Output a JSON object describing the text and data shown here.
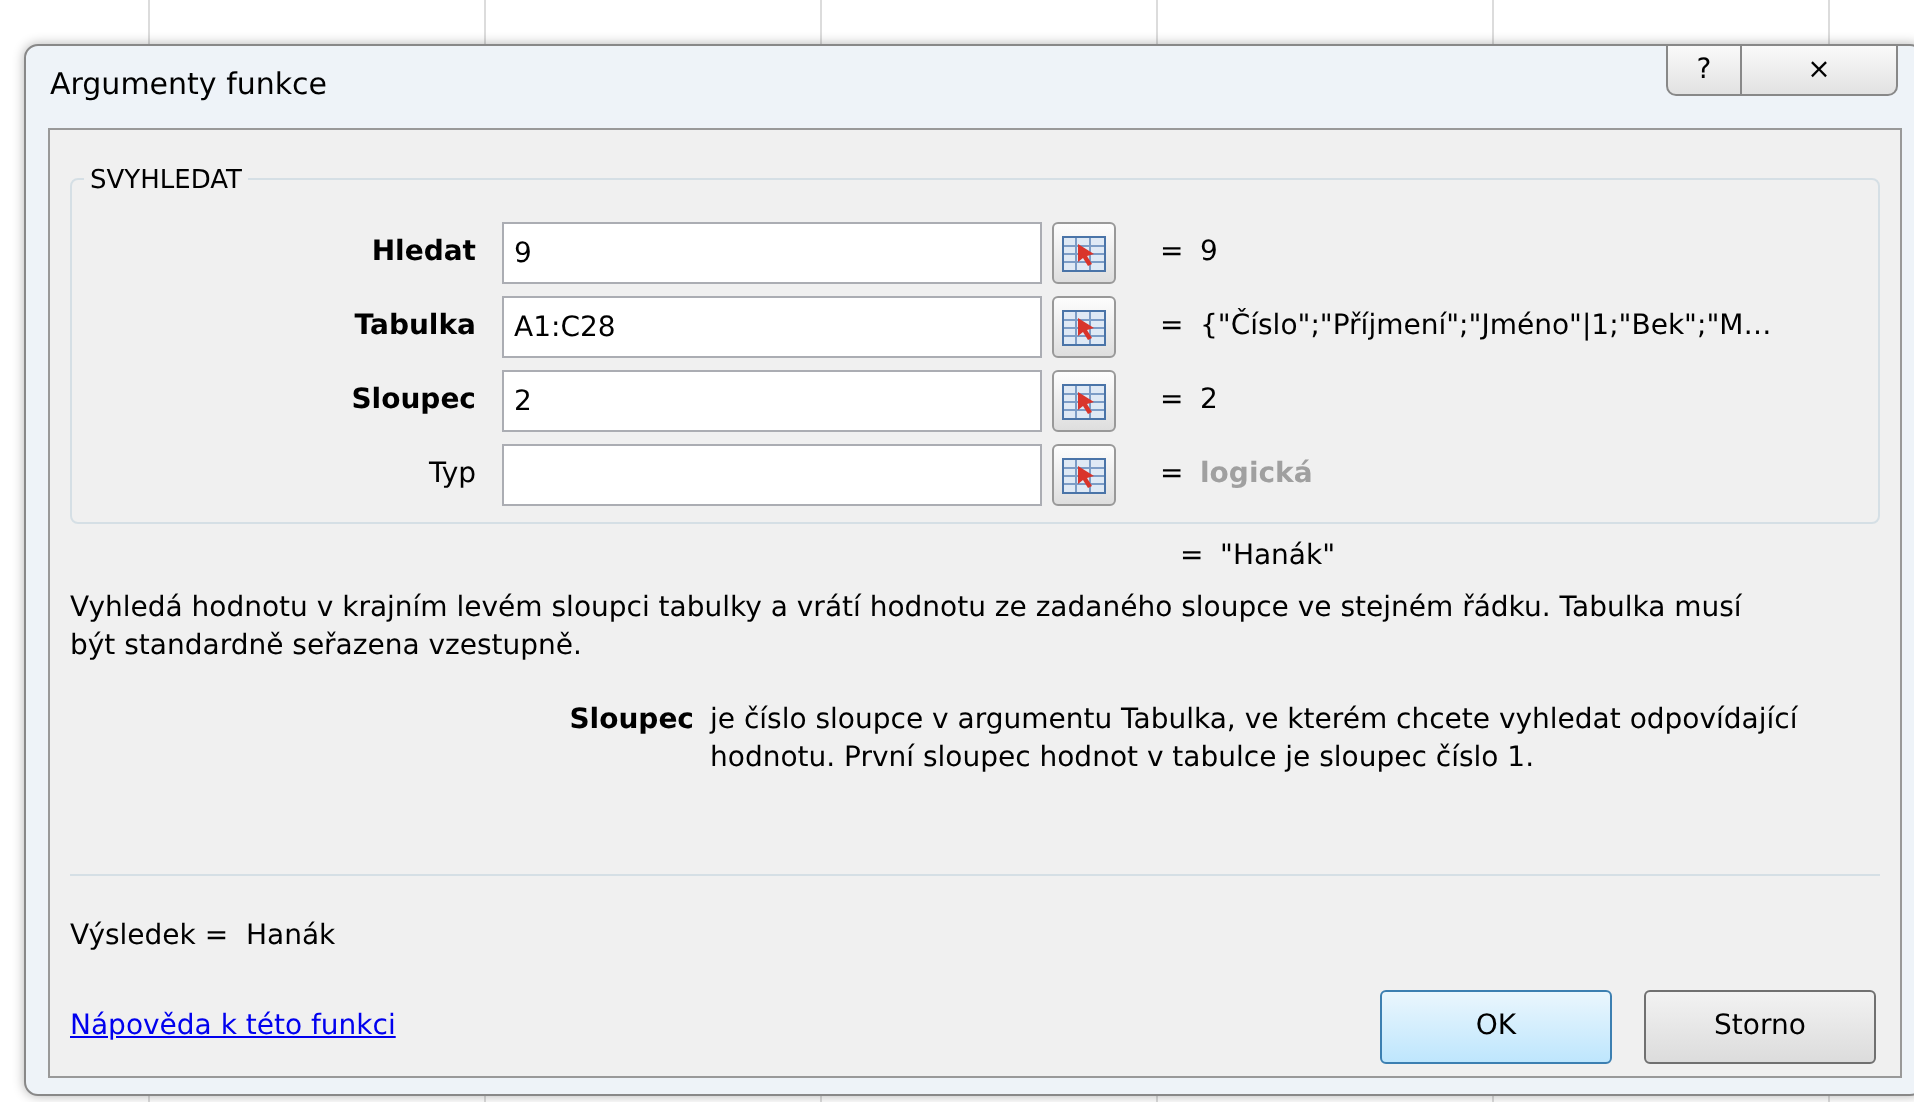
{
  "window": {
    "title": "Argumenty funkce",
    "help_button": "?",
    "close_button": "×"
  },
  "function_name": "SVYHLEDAT",
  "arguments": [
    {
      "label": "Hledat",
      "required": true,
      "value": "9",
      "equals": "=",
      "result": "9",
      "dimmed": false
    },
    {
      "label": "Tabulka",
      "required": true,
      "value": "A1:C28",
      "equals": "=",
      "result": "{\"Číslo\";\"Příjmení\";\"Jméno\"|1;\"Bek\";\"M…",
      "dimmed": false
    },
    {
      "label": "Sloupec",
      "required": true,
      "value": "2",
      "equals": "=",
      "result": "2",
      "dimmed": false
    },
    {
      "label": "Typ",
      "required": false,
      "equals": "=",
      "result": "logická",
      "dimmed": true
    }
  ],
  "formula_equals": "=",
  "formula_result": "\"Hanák\"",
  "description": "Vyhledá hodnotu v krajním levém sloupci tabulky a vrátí hodnotu ze zadaného sloupce ve stejném řádku. Tabulka musí být standardně seřazena vzestupně.",
  "argument_help": {
    "name": "Sloupec",
    "text": "je číslo sloupce v argumentu Tabulka, ve kterém chcete vyhledat odpovídající hodnotu. První sloupec hodnot v tabulce je sloupec číslo 1."
  },
  "result_label": "Výsledek =",
  "result_value": "Hanák",
  "help_link": "Nápověda k této funkci",
  "buttons": [
    {
      "label": "OK",
      "default": true
    },
    {
      "label": "Storno",
      "default": false
    }
  ]
}
